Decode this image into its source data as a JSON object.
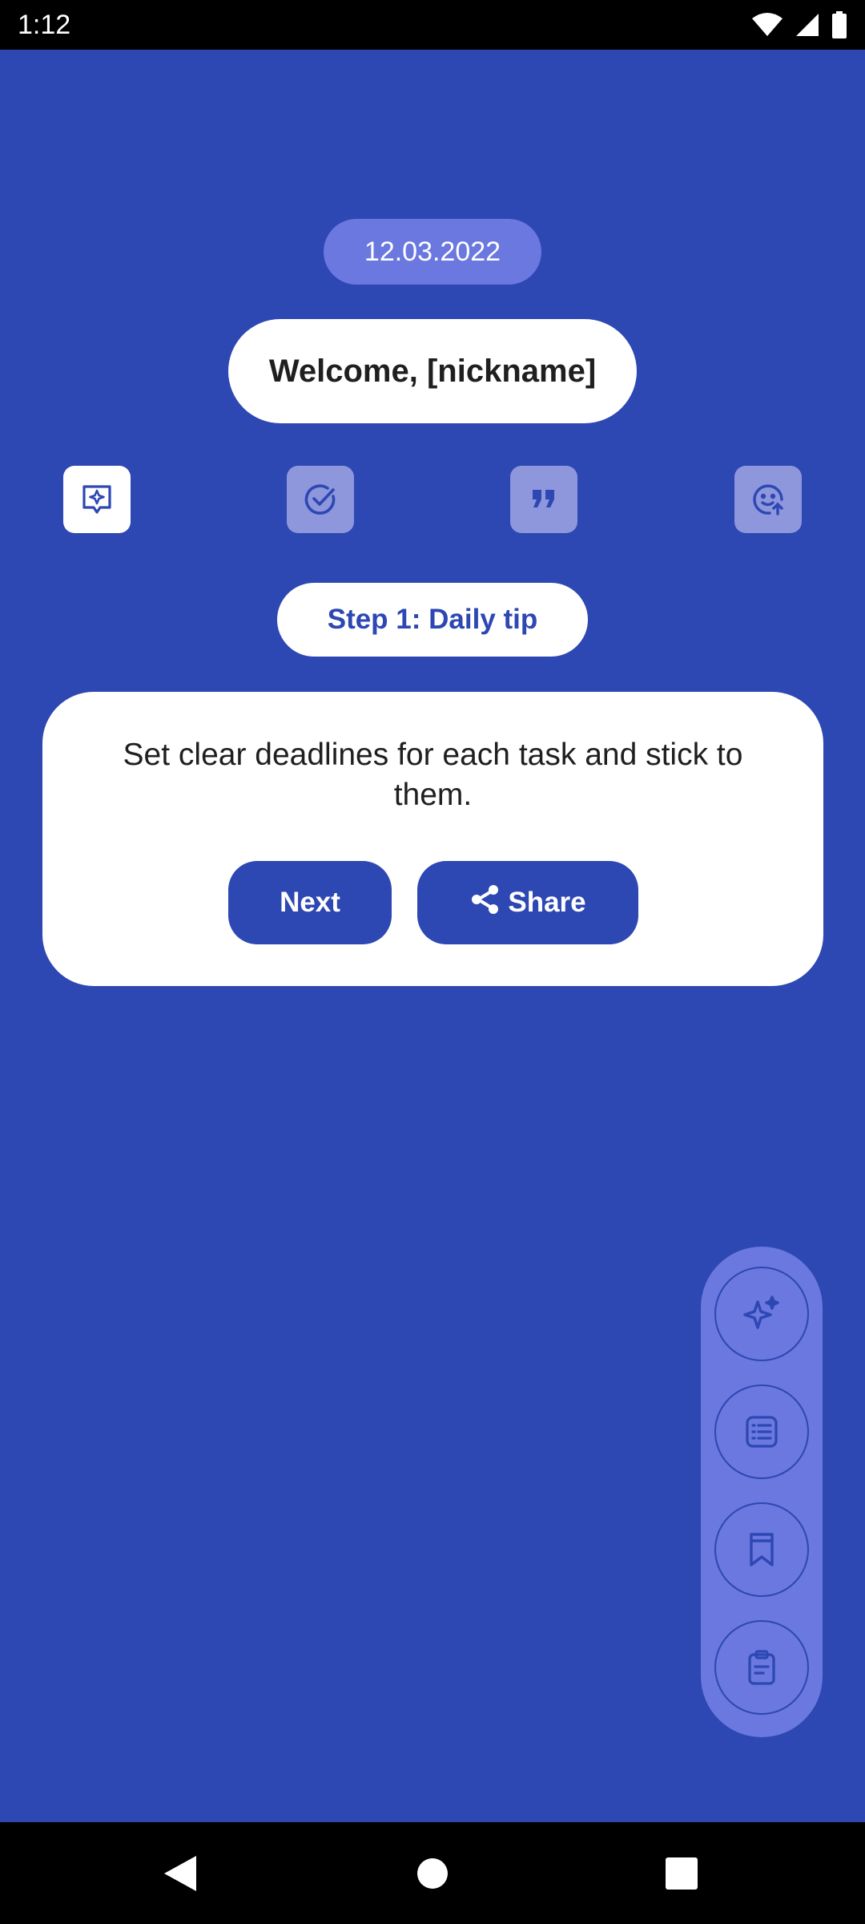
{
  "status_bar": {
    "time": "1:12",
    "icons": [
      "wifi-icon",
      "signal-icon",
      "battery-icon"
    ]
  },
  "header": {
    "date": "12.03.2022",
    "welcome": "Welcome, [nickname]"
  },
  "tabs": [
    {
      "icon": "tip-icon",
      "active": true
    },
    {
      "icon": "check-circle-icon",
      "active": false
    },
    {
      "icon": "quote-icon",
      "active": false
    },
    {
      "icon": "smiley-icon",
      "active": false
    }
  ],
  "step": {
    "label": "Step 1: Daily tip"
  },
  "tip": {
    "text": "Set clear deadlines for each task and stick to them.",
    "next_label": "Next",
    "share_label": "Share"
  },
  "dock": {
    "items": [
      "sparkle-icon",
      "list-icon",
      "bookmark-icon",
      "clipboard-icon"
    ]
  },
  "nav": {
    "items": [
      "back-icon",
      "home-icon",
      "recents-icon"
    ]
  },
  "colors": {
    "background": "#2D47B3",
    "pill": "#6A78DF",
    "tab_inactive": "#8E97DC",
    "white": "#FFFFFF"
  }
}
